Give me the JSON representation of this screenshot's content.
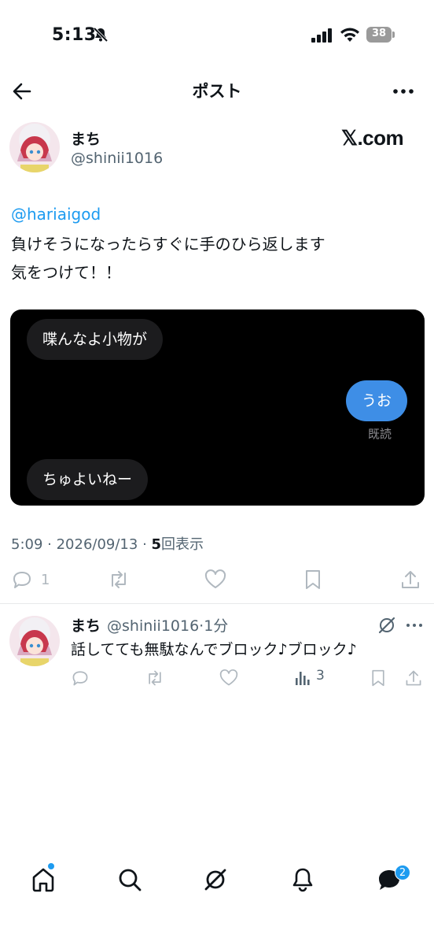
{
  "status_bar": {
    "time": "5:13",
    "battery": "38"
  },
  "header": {
    "title": "ポスト"
  },
  "post": {
    "author_name": "まち",
    "author_handle": "@shinii1016",
    "watermark": "𝕏.com",
    "mention": "@hariaigod",
    "text_line1": "負けそうになったらすぐに手のひら返します",
    "text_line2": "気をつけて！！",
    "image": {
      "bubble_incoming_1": "喋んなよ小物が",
      "bubble_outgoing": "うお",
      "read_receipt": "既読",
      "bubble_incoming_2": "ちゅよいねー"
    },
    "time": "5:09",
    "date": "2026/09/13",
    "views_count": "5",
    "views_label": "回表示",
    "reply_count": "1"
  },
  "reply": {
    "author_name": "まち",
    "handle_time": "@shinii1016·1分",
    "text": "話してても無駄なんでブロック♪ブロック♪",
    "views": "3"
  },
  "tabbar": {
    "messages_badge": "2"
  },
  "colors": {
    "accent": "#1d9bf0",
    "bubble_outgoing": "#3e8ee6",
    "bubble_incoming": "#1c1c1e"
  }
}
